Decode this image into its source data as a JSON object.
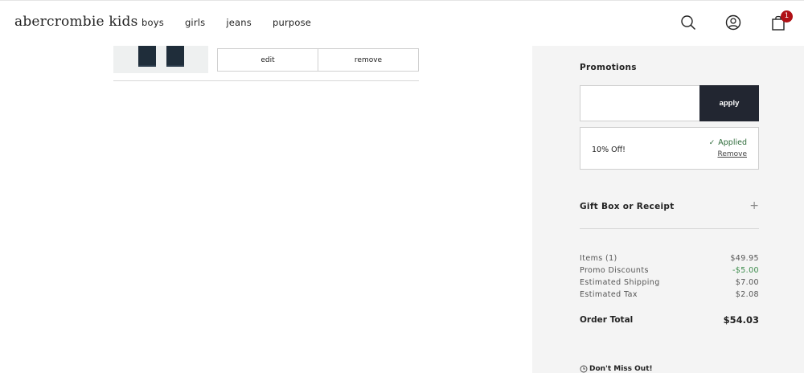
{
  "header": {
    "logo": "abercrombie kids",
    "nav": [
      "boys",
      "girls",
      "jeans",
      "purpose"
    ],
    "bag_count": "1",
    "icons": [
      "search-icon",
      "account-icon",
      "shopping-bag-icon"
    ]
  },
  "cart_item": {
    "edit_label": "edit",
    "remove_label": "remove"
  },
  "promotions": {
    "title": "Promotions",
    "input_value": "",
    "apply_label": "apply",
    "applied_code": "10% Off!",
    "applied_status": "Applied",
    "remove_label": "Remove"
  },
  "gift": {
    "label": "Gift Box or Receipt"
  },
  "summary": {
    "rows": [
      {
        "label": "Items (1)",
        "value": "$49.95"
      },
      {
        "label": "Promo Discounts",
        "value": "-$5.00"
      },
      {
        "label": "Estimated Shipping",
        "value": "$7.00"
      },
      {
        "label": "Estimated Tax",
        "value": "$2.08"
      }
    ],
    "total_label": "Order Total",
    "total_value": "$54.03"
  },
  "notice": {
    "text": "Don't Miss Out!"
  },
  "colors": {
    "accent_dark": "#222631",
    "discount_green": "#3a8a4a",
    "badge_red": "#b01116",
    "panel_bg": "#f4f4f4"
  }
}
